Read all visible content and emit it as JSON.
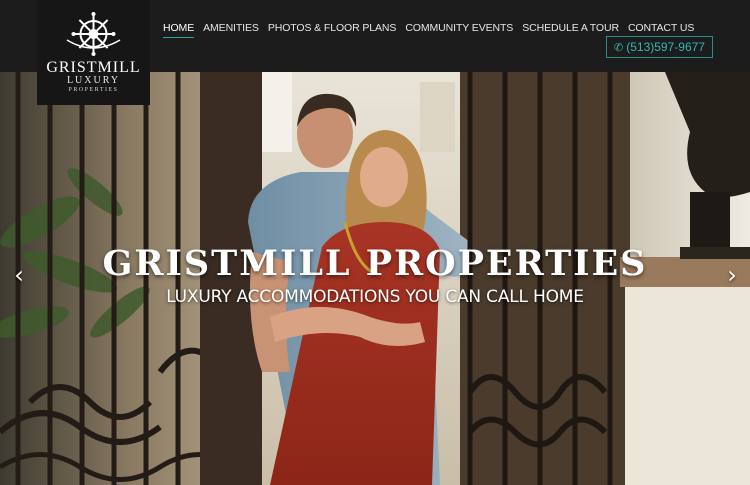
{
  "logo": {
    "name": "GRISTMILL",
    "luxury": "LUXURY",
    "properties": "PROPERTIES",
    "icon": "ship-wheel-icon"
  },
  "nav": {
    "items": [
      {
        "label": "HOME",
        "active": true
      },
      {
        "label": "AMENITIES",
        "active": false
      },
      {
        "label": "PHOTOS & FLOOR PLANS",
        "active": false
      },
      {
        "label": "COMMUNITY EVENTS",
        "active": false
      },
      {
        "label": "SCHEDULE A TOUR",
        "active": false
      },
      {
        "label": "CONTACT US",
        "active": false
      }
    ]
  },
  "phone": {
    "icon": "phone-icon",
    "number": "(513)597-9677"
  },
  "hero": {
    "title": "GRISTMILL PROPERTIES",
    "subtitle": "LUXURY ACCOMMODATIONS YOU CAN CALL HOME",
    "prev_icon": "chevron-left-icon",
    "next_icon": "chevron-right-icon",
    "prev_glyph": "‹",
    "next_glyph": "›"
  },
  "colors": {
    "header_bg": "#1c1c1c",
    "accent": "#25a3a3",
    "phone_text": "#35b6b6"
  }
}
